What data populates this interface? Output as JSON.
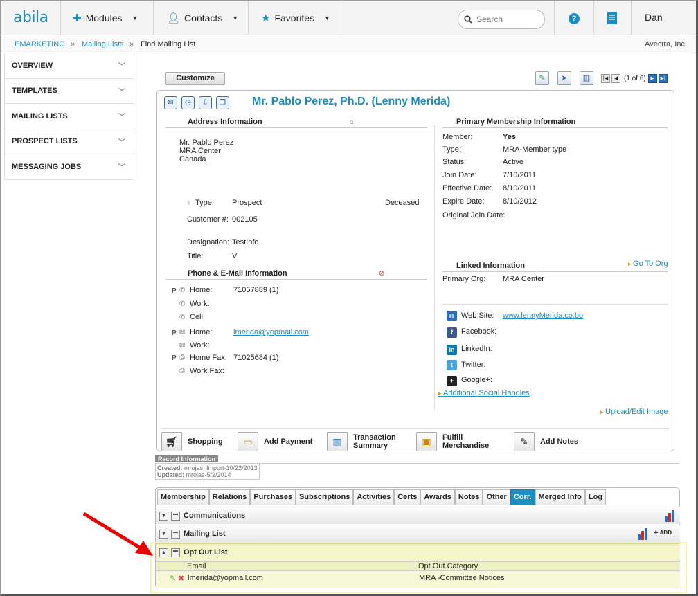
{
  "brand": {
    "logo": "abila",
    "accent": "#1a8ec0"
  },
  "nav": {
    "modules": "Modules",
    "contacts": "Contacts",
    "favorites": "Favorites",
    "search_placeholder": "Search",
    "user": "Dan"
  },
  "breadcrumb": {
    "item1": "EMARKETING",
    "item2": "Mailing Lists",
    "item3": "Find Mailing List",
    "sep": "»",
    "org": "Avectra, Inc."
  },
  "sidebar": {
    "items": [
      "OVERVIEW",
      "TEMPLATES",
      "MAILING LISTS",
      "PROSPECT LISTS",
      "MESSAGING JOBS"
    ]
  },
  "toolbar": {
    "customize": "Customize",
    "pager_text": "(1 of 6)"
  },
  "record": {
    "name": "Mr. Pablo Perez, Ph.D. (Lenny Merida)",
    "address": {
      "heading": "Address Information",
      "line1": "Mr. Pablo Perez",
      "line2": "MRA Center",
      "line3": "Canada"
    },
    "type_label": "Type:",
    "type_value": "Prospect",
    "deceased": "Deceased",
    "customer_label": "Customer #:",
    "customer_value": "002105",
    "designation_label": "Designation:",
    "designation_value": "TestInfo",
    "title_label": "Title:",
    "title_value": "V",
    "phone_heading": "Phone & E-Mail Information",
    "phones": {
      "p": "P",
      "home_label": "Home:",
      "home_value": "71057889 (1)",
      "work_label": "Work:",
      "cell_label": "Cell:",
      "email_home_label": "Home:",
      "email_home_value": "lmerida@yopmail.com",
      "email_work_label": "Work:",
      "fax_home_label": "Home Fax:",
      "fax_home_value": "71025684 (1)",
      "fax_work_label": "Work Fax:"
    },
    "membership": {
      "heading": "Primary Membership Information",
      "member_label": "Member:",
      "member_value": "Yes",
      "type_label": "Type:",
      "type_value": "MRA-Member type",
      "status_label": "Status:",
      "status_value": "Active",
      "join_label": "Join Date:",
      "join_value": "7/10/2011",
      "effective_label": "Effective Date:",
      "effective_value": "8/10/2011",
      "expire_label": "Expire Date:",
      "expire_value": "8/10/2012",
      "original_label": "Original Join Date:"
    },
    "linked": {
      "heading": "Linked Information",
      "go_to_org": "Go To Org",
      "primary_org_label": "Primary Org:",
      "primary_org_value": "MRA Center"
    },
    "social": {
      "website_label": "Web Site:",
      "website_value": "www.lennyMerida.co.bo",
      "facebook": "Facebook:",
      "linkedin": "LinkedIn:",
      "twitter": "Twitter:",
      "google": "Google+:",
      "additional": "Additional Social Handles",
      "upload": "Upload/Edit Image"
    },
    "actions": {
      "shopping": "Shopping",
      "add_payment": "Add Payment",
      "transaction_1": "Transaction",
      "transaction_2": "Summary",
      "fulfill_1": "Fulfill",
      "fulfill_2": "Merchandise",
      "add_notes": "Add Notes"
    }
  },
  "record_info": {
    "heading": "Record Information",
    "created_label": "Created:",
    "created_value": "mrojas_Import-10/22/2013",
    "updated_label": "Updated:",
    "updated_value": "mrojas-5/2/2014"
  },
  "tabs": [
    "Membership",
    "Relations",
    "Purchases",
    "Subscriptions",
    "Activities",
    "Certs",
    "Awards",
    "Notes",
    "Other",
    "Corr.",
    "Merged Info",
    "Log"
  ],
  "active_tab": "Corr.",
  "sections": {
    "communications": "Communications",
    "mailing_list": "Mailing List",
    "add": "ADD",
    "opt_out": "Opt Out List",
    "col_email": "Email",
    "col_category": "Opt Out Category",
    "row_email": "lmerida@yopmail.com",
    "row_category": "MRA -Committee Notices"
  }
}
